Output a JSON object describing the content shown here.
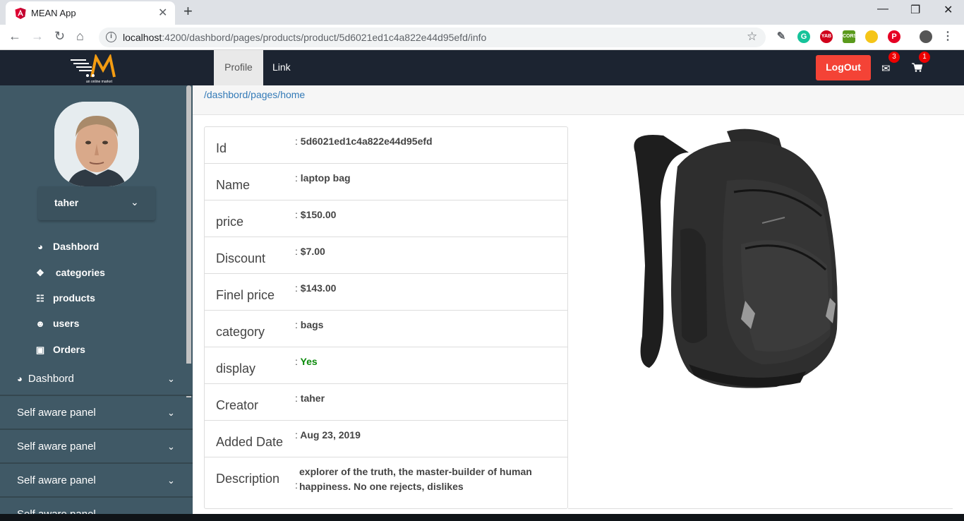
{
  "browser": {
    "tab_title": "MEAN App",
    "tab_close": "✕",
    "new_tab": "+",
    "url_host": "localhost",
    "url_path": ":4200/dashbord/pages/products/product/5d6021ed1c4a822e44d95efd/info",
    "extensions": [
      "YAB",
      "CORS"
    ]
  },
  "header": {
    "logo_subtitle": "an online market",
    "tabs": [
      {
        "label": "Profile"
      },
      {
        "label": "Link"
      }
    ],
    "logout_label": "LogOut",
    "mail_badge": "3",
    "cart_badge": "1"
  },
  "sidebar": {
    "user_name": "taher",
    "menu": [
      {
        "label": "Dashbord",
        "icon": "dashboard-icon"
      },
      {
        "label": "categories",
        "icon": "cubes-icon"
      },
      {
        "label": "products",
        "icon": "barcode-icon"
      },
      {
        "label": "users",
        "icon": "users-icon"
      },
      {
        "label": "Orders",
        "icon": "shopping-bag-icon"
      }
    ],
    "panels": [
      {
        "label": "Dashbord"
      },
      {
        "label": "Self aware panel"
      },
      {
        "label": "Self aware panel"
      },
      {
        "label": "Self aware panel"
      },
      {
        "label": "Self aware panel"
      }
    ]
  },
  "main": {
    "breadcrumb": "/dashbord/pages/home",
    "rows": [
      {
        "label": "Id",
        "value": "5d6021ed1c4a822e44d95efd"
      },
      {
        "label": "Name",
        "value": "laptop bag"
      },
      {
        "label": "price",
        "value": "$150.00"
      },
      {
        "label": "Discount",
        "value": "$7.00"
      },
      {
        "label": "Finel price",
        "value": "$143.00"
      },
      {
        "label": "category",
        "value": "bags"
      },
      {
        "label": "display",
        "value": "Yes"
      },
      {
        "label": "Creator",
        "value": "taher"
      },
      {
        "label": "Added Date",
        "value": "Aug 23, 2019"
      },
      {
        "label": "Description",
        "value": "explorer of the truth, the master-builder of human happiness. No one rejects, dislikes"
      }
    ]
  },
  "colors": {
    "header_bg": "#1c2431",
    "sidebar_bg": "#405966",
    "logout_bg": "#f44336",
    "link_blue": "#337ab7",
    "yes_green": "#0a8a0a"
  }
}
